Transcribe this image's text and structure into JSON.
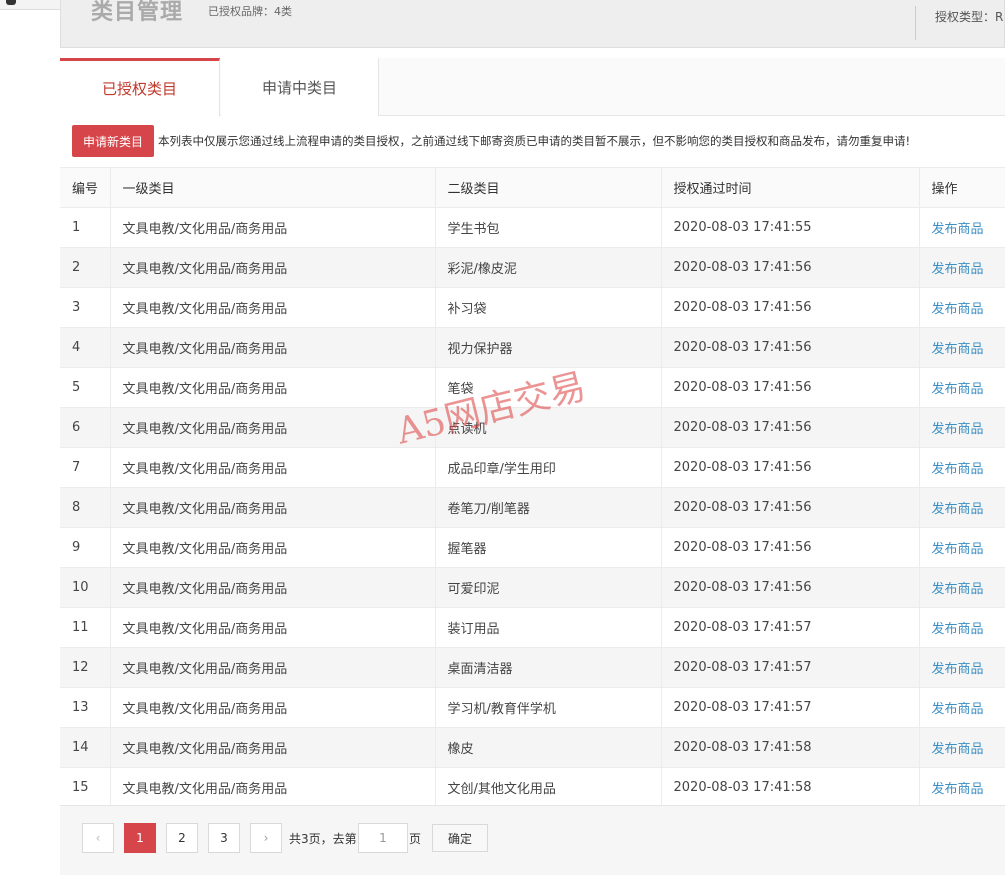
{
  "header": {
    "title": "类目管理",
    "subtitle": "已授权品牌：4类",
    "auth_type": "授权类型：R"
  },
  "tabs": [
    {
      "label": "已授权类目",
      "active": true
    },
    {
      "label": "申请中类目",
      "active": false
    }
  ],
  "notice": {
    "button_label": "申请新类目",
    "text": "本列表中仅展示您通过线上流程申请的类目授权，之前通过线下邮寄资质已申请的类目暂不展示，但不影响您的类目授权和商品发布，请勿重复申请!"
  },
  "table": {
    "headers": [
      "编号",
      "一级类目",
      "二级类目",
      "授权通过时间",
      "操作"
    ],
    "rows": [
      {
        "id": "1",
        "cat1": "文具电教/文化用品/商务用品",
        "cat2": "学生书包",
        "time": "2020-08-03 17:41:55",
        "op": "发布商品"
      },
      {
        "id": "2",
        "cat1": "文具电教/文化用品/商务用品",
        "cat2": "彩泥/橡皮泥",
        "time": "2020-08-03 17:41:56",
        "op": "发布商品"
      },
      {
        "id": "3",
        "cat1": "文具电教/文化用品/商务用品",
        "cat2": "补习袋",
        "time": "2020-08-03 17:41:56",
        "op": "发布商品"
      },
      {
        "id": "4",
        "cat1": "文具电教/文化用品/商务用品",
        "cat2": "视力保护器",
        "time": "2020-08-03 17:41:56",
        "op": "发布商品"
      },
      {
        "id": "5",
        "cat1": "文具电教/文化用品/商务用品",
        "cat2": "笔袋",
        "time": "2020-08-03 17:41:56",
        "op": "发布商品"
      },
      {
        "id": "6",
        "cat1": "文具电教/文化用品/商务用品",
        "cat2": "点读机",
        "time": "2020-08-03 17:41:56",
        "op": "发布商品"
      },
      {
        "id": "7",
        "cat1": "文具电教/文化用品/商务用品",
        "cat2": "成品印章/学生用印",
        "time": "2020-08-03 17:41:56",
        "op": "发布商品"
      },
      {
        "id": "8",
        "cat1": "文具电教/文化用品/商务用品",
        "cat2": "卷笔刀/削笔器",
        "time": "2020-08-03 17:41:56",
        "op": "发布商品"
      },
      {
        "id": "9",
        "cat1": "文具电教/文化用品/商务用品",
        "cat2": "握笔器",
        "time": "2020-08-03 17:41:56",
        "op": "发布商品"
      },
      {
        "id": "10",
        "cat1": "文具电教/文化用品/商务用品",
        "cat2": "可爱印泥",
        "time": "2020-08-03 17:41:56",
        "op": "发布商品"
      },
      {
        "id": "11",
        "cat1": "文具电教/文化用品/商务用品",
        "cat2": "装订用品",
        "time": "2020-08-03 17:41:57",
        "op": "发布商品"
      },
      {
        "id": "12",
        "cat1": "文具电教/文化用品/商务用品",
        "cat2": "桌面清洁器",
        "time": "2020-08-03 17:41:57",
        "op": "发布商品"
      },
      {
        "id": "13",
        "cat1": "文具电教/文化用品/商务用品",
        "cat2": "学习机/教育伴学机",
        "time": "2020-08-03 17:41:57",
        "op": "发布商品"
      },
      {
        "id": "14",
        "cat1": "文具电教/文化用品/商务用品",
        "cat2": "橡皮",
        "time": "2020-08-03 17:41:58",
        "op": "发布商品"
      },
      {
        "id": "15",
        "cat1": "文具电教/文化用品/商务用品",
        "cat2": "文创/其他文化用品",
        "time": "2020-08-03 17:41:58",
        "op": "发布商品"
      }
    ]
  },
  "pager": {
    "prev_icon": "chevron-left-icon",
    "pages": [
      "1",
      "2",
      "3"
    ],
    "current_page": 1,
    "next_icon": "chevron-right-icon",
    "total_text": "共3页，去第",
    "goto_value": "1",
    "unit_text": "页",
    "confirm_label": "确定"
  },
  "watermark": "A5网店交易",
  "colors": {
    "accent": "#d6454a",
    "link": "#3b8fc4"
  }
}
